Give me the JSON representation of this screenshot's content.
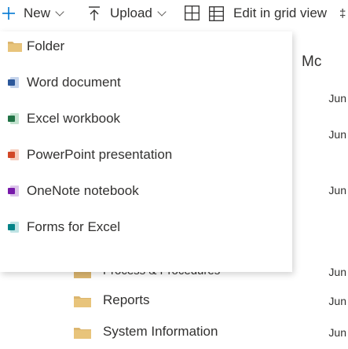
{
  "toolbar": {
    "new_label": "New",
    "upload_label": "Upload",
    "edit_grid_label": "Edit in grid view",
    "more_glyph": "‡"
  },
  "background": {
    "column_header_modified": "Mc",
    "rows": [
      {
        "name": "Process & Procedures",
        "date": "Jun",
        "icon": "folder-icon"
      },
      {
        "name": "Reports",
        "date": "Jun",
        "icon": "folder-icon"
      },
      {
        "name": "System Information",
        "date": "Jun",
        "icon": "folder-icon"
      }
    ],
    "dates_upper": [
      "Jun",
      "Jun",
      "Jun"
    ]
  },
  "new_menu": {
    "items": [
      {
        "label": "Folder",
        "icon": "folder-icon"
      },
      {
        "label": "Word document",
        "icon": "word-icon"
      },
      {
        "label": "Excel workbook",
        "icon": "excel-icon"
      },
      {
        "label": "PowerPoint presentation",
        "icon": "powerpoint-icon"
      },
      {
        "label": "OneNote notebook",
        "icon": "onenote-icon"
      },
      {
        "label": "Forms for Excel",
        "icon": "forms-icon"
      }
    ]
  },
  "colors": {
    "accent": "#0078d4",
    "folder": "#dcb66f",
    "word": "#2b579a",
    "excel": "#217346",
    "powerpoint": "#d24726",
    "onenote": "#7719aa",
    "forms": "#038387"
  }
}
